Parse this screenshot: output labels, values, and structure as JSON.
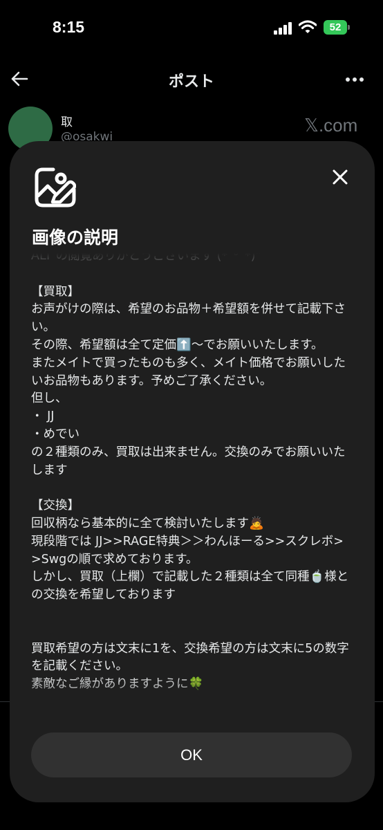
{
  "status_bar": {
    "time": "8:15",
    "battery": "52"
  },
  "header": {
    "title": "ポスト",
    "back_icon": "back-arrow-icon",
    "more_icon": "more-icon"
  },
  "author": {
    "name": "取",
    "handle": "@osakwi",
    "brand": "𝕏.com"
  },
  "modal": {
    "icon": "image-description-icon",
    "close_icon": "close-icon",
    "title": "画像の説明",
    "description": "ALT の閲覧ありがとうございます (*ˊᵕˋ*)\"\n\n【買取】\nお声がけの際は、希望のお品物＋希望額を併せて記載下さい。\nその際、希望額は全て定価⬆️〜でお願いいたします。\nまたメイトで買ったものも多く、メイト価格でお願いしたいお品物もあります。予めご了承ください。\n但し、\n・ JJ\n・めでい\nの２種類のみ、買取は出来ません。交換のみでお願いいたします\n\n【交換】\n回収柄なら基本的に全て検討いたします🙇\n現段階では JJ>>RAGE特典＞＞わんほーる>>スクレボ>>Swgの順で求めております。\nしかし、買取（上欄）で記載した２種類は全て同種🍵様との交換を希望しております\n\n\n買取希望の方は文末に1を、交換希望の方は文末に5の数字を記載ください。\n素敵なご縁がありますように🍀",
    "ok_label": "OK"
  },
  "colors": {
    "background": "#000000",
    "modal": "#1f1f1f",
    "button": "#313131",
    "avatar": "#2e6b45",
    "battery": "#34c759"
  }
}
